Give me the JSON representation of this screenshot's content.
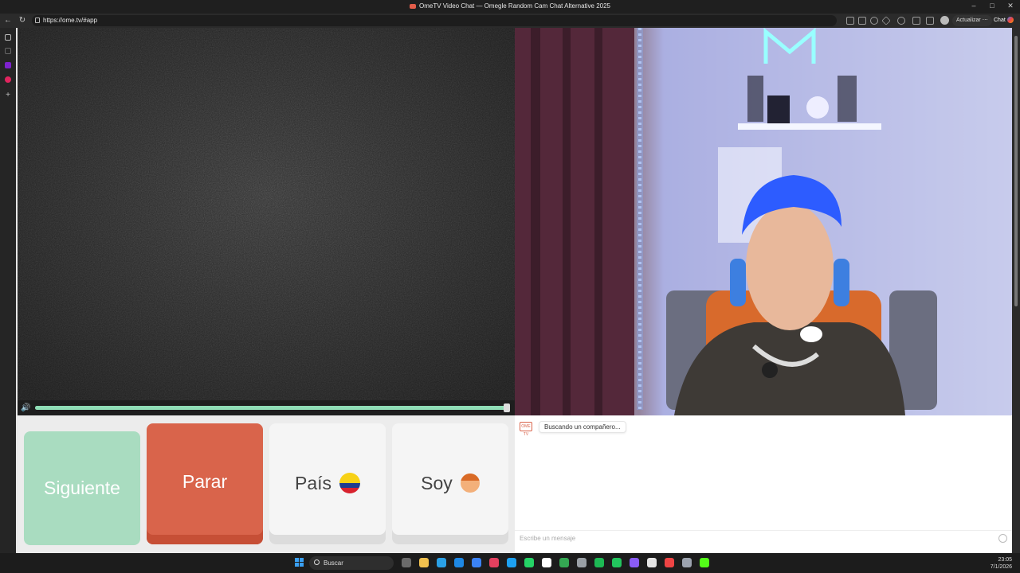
{
  "window": {
    "title": "OmeTV Video Chat — Omegle Random Cam Chat Alternative 2025",
    "controls": [
      "–",
      "□",
      "✕"
    ]
  },
  "browser": {
    "url": "https://ome.tv/#app",
    "update_label": "Actualizar",
    "update_more": "⋯",
    "chat_label": "Chat"
  },
  "player": {
    "volume_level": 1.0
  },
  "buttons": {
    "next": "Siguiente",
    "stop": "Parar",
    "country": "País",
    "gender": "Soy"
  },
  "country_flag": {
    "colors": [
      "#f7d116",
      "#1f3c8f",
      "#d8222e"
    ]
  },
  "chat": {
    "logo_text": "OME TV",
    "status": "Buscando un compañero...",
    "input_placeholder": "Escribe un mensaje"
  },
  "taskbar": {
    "search_label": "Buscar",
    "time": "23:05",
    "date": "7/1/2026",
    "app_colors": [
      "#6b6b6b",
      "#f2c14e",
      "#2aa0e6",
      "#1e88e5",
      "#3b82f6",
      "#e4405f",
      "#1da1f2",
      "#25d366",
      "#ffffff",
      "#34a853",
      "#9aa0a6",
      "#1db954",
      "#22c55e",
      "#8b5cf6",
      "#e5e5e5",
      "#ef4444",
      "#9ca3af",
      "#53fc18"
    ]
  }
}
